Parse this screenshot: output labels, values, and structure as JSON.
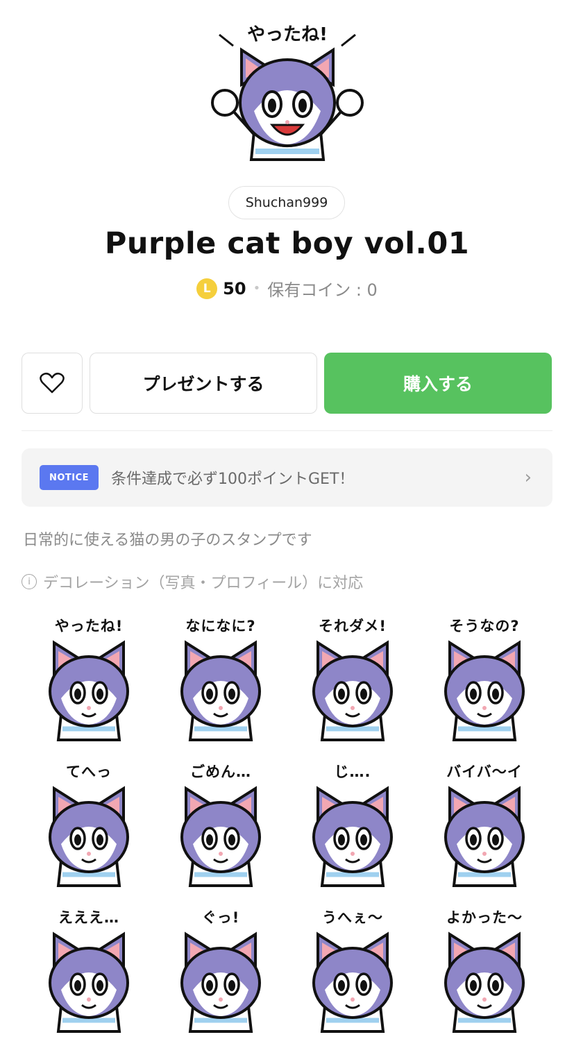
{
  "hero": {
    "caption": "やったね!"
  },
  "author": "Shuchan999",
  "title": "Purple cat boy vol.01",
  "price": {
    "coin_icon": "L",
    "amount": "50",
    "separator": "•",
    "owned": "保有コイン : 0"
  },
  "buttons": {
    "favorite_icon": "heart-icon",
    "gift": "プレゼントする",
    "buy": "購入する"
  },
  "colors": {
    "buy": "#57c25f",
    "notice_badge": "#5b78f0",
    "coin": "#f5cf3c",
    "cat": "#8e86c8",
    "ear": "#f2a7b2",
    "stripe": "#9fd0ef"
  },
  "notice": {
    "badge": "NOTICE",
    "text": "条件達成で必ず100ポイントGET！",
    "arrow": "›"
  },
  "description": "日常的に使える猫の男の子のスタンプです",
  "decoration": {
    "icon": "i",
    "text": "デコレーション（写真・プロフィール）に対応"
  },
  "stickers": [
    {
      "label": "やったね!"
    },
    {
      "label": "なになに?"
    },
    {
      "label": "それダメ!"
    },
    {
      "label": "そうなの?"
    },
    {
      "label": "てへっ"
    },
    {
      "label": "ごめん…"
    },
    {
      "label": "じ…."
    },
    {
      "label": "バイバ〜イ"
    },
    {
      "label": "えええ…"
    },
    {
      "label": "ぐっ!"
    },
    {
      "label": "うへぇ〜"
    },
    {
      "label": "よかった〜"
    }
  ]
}
